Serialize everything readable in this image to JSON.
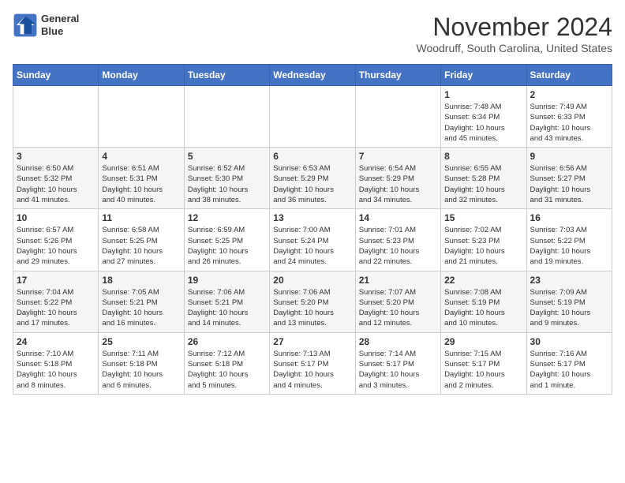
{
  "header": {
    "logo_line1": "General",
    "logo_line2": "Blue",
    "month": "November 2024",
    "location": "Woodruff, South Carolina, United States"
  },
  "weekdays": [
    "Sunday",
    "Monday",
    "Tuesday",
    "Wednesday",
    "Thursday",
    "Friday",
    "Saturday"
  ],
  "weeks": [
    [
      {
        "day": "",
        "info": ""
      },
      {
        "day": "",
        "info": ""
      },
      {
        "day": "",
        "info": ""
      },
      {
        "day": "",
        "info": ""
      },
      {
        "day": "",
        "info": ""
      },
      {
        "day": "1",
        "info": "Sunrise: 7:48 AM\nSunset: 6:34 PM\nDaylight: 10 hours\nand 45 minutes."
      },
      {
        "day": "2",
        "info": "Sunrise: 7:49 AM\nSunset: 6:33 PM\nDaylight: 10 hours\nand 43 minutes."
      }
    ],
    [
      {
        "day": "3",
        "info": "Sunrise: 6:50 AM\nSunset: 5:32 PM\nDaylight: 10 hours\nand 41 minutes."
      },
      {
        "day": "4",
        "info": "Sunrise: 6:51 AM\nSunset: 5:31 PM\nDaylight: 10 hours\nand 40 minutes."
      },
      {
        "day": "5",
        "info": "Sunrise: 6:52 AM\nSunset: 5:30 PM\nDaylight: 10 hours\nand 38 minutes."
      },
      {
        "day": "6",
        "info": "Sunrise: 6:53 AM\nSunset: 5:29 PM\nDaylight: 10 hours\nand 36 minutes."
      },
      {
        "day": "7",
        "info": "Sunrise: 6:54 AM\nSunset: 5:29 PM\nDaylight: 10 hours\nand 34 minutes."
      },
      {
        "day": "8",
        "info": "Sunrise: 6:55 AM\nSunset: 5:28 PM\nDaylight: 10 hours\nand 32 minutes."
      },
      {
        "day": "9",
        "info": "Sunrise: 6:56 AM\nSunset: 5:27 PM\nDaylight: 10 hours\nand 31 minutes."
      }
    ],
    [
      {
        "day": "10",
        "info": "Sunrise: 6:57 AM\nSunset: 5:26 PM\nDaylight: 10 hours\nand 29 minutes."
      },
      {
        "day": "11",
        "info": "Sunrise: 6:58 AM\nSunset: 5:25 PM\nDaylight: 10 hours\nand 27 minutes."
      },
      {
        "day": "12",
        "info": "Sunrise: 6:59 AM\nSunset: 5:25 PM\nDaylight: 10 hours\nand 26 minutes."
      },
      {
        "day": "13",
        "info": "Sunrise: 7:00 AM\nSunset: 5:24 PM\nDaylight: 10 hours\nand 24 minutes."
      },
      {
        "day": "14",
        "info": "Sunrise: 7:01 AM\nSunset: 5:23 PM\nDaylight: 10 hours\nand 22 minutes."
      },
      {
        "day": "15",
        "info": "Sunrise: 7:02 AM\nSunset: 5:23 PM\nDaylight: 10 hours\nand 21 minutes."
      },
      {
        "day": "16",
        "info": "Sunrise: 7:03 AM\nSunset: 5:22 PM\nDaylight: 10 hours\nand 19 minutes."
      }
    ],
    [
      {
        "day": "17",
        "info": "Sunrise: 7:04 AM\nSunset: 5:22 PM\nDaylight: 10 hours\nand 17 minutes."
      },
      {
        "day": "18",
        "info": "Sunrise: 7:05 AM\nSunset: 5:21 PM\nDaylight: 10 hours\nand 16 minutes."
      },
      {
        "day": "19",
        "info": "Sunrise: 7:06 AM\nSunset: 5:21 PM\nDaylight: 10 hours\nand 14 minutes."
      },
      {
        "day": "20",
        "info": "Sunrise: 7:06 AM\nSunset: 5:20 PM\nDaylight: 10 hours\nand 13 minutes."
      },
      {
        "day": "21",
        "info": "Sunrise: 7:07 AM\nSunset: 5:20 PM\nDaylight: 10 hours\nand 12 minutes."
      },
      {
        "day": "22",
        "info": "Sunrise: 7:08 AM\nSunset: 5:19 PM\nDaylight: 10 hours\nand 10 minutes."
      },
      {
        "day": "23",
        "info": "Sunrise: 7:09 AM\nSunset: 5:19 PM\nDaylight: 10 hours\nand 9 minutes."
      }
    ],
    [
      {
        "day": "24",
        "info": "Sunrise: 7:10 AM\nSunset: 5:18 PM\nDaylight: 10 hours\nand 8 minutes."
      },
      {
        "day": "25",
        "info": "Sunrise: 7:11 AM\nSunset: 5:18 PM\nDaylight: 10 hours\nand 6 minutes."
      },
      {
        "day": "26",
        "info": "Sunrise: 7:12 AM\nSunset: 5:18 PM\nDaylight: 10 hours\nand 5 minutes."
      },
      {
        "day": "27",
        "info": "Sunrise: 7:13 AM\nSunset: 5:17 PM\nDaylight: 10 hours\nand 4 minutes."
      },
      {
        "day": "28",
        "info": "Sunrise: 7:14 AM\nSunset: 5:17 PM\nDaylight: 10 hours\nand 3 minutes."
      },
      {
        "day": "29",
        "info": "Sunrise: 7:15 AM\nSunset: 5:17 PM\nDaylight: 10 hours\nand 2 minutes."
      },
      {
        "day": "30",
        "info": "Sunrise: 7:16 AM\nSunset: 5:17 PM\nDaylight: 10 hours\nand 1 minute."
      }
    ]
  ]
}
